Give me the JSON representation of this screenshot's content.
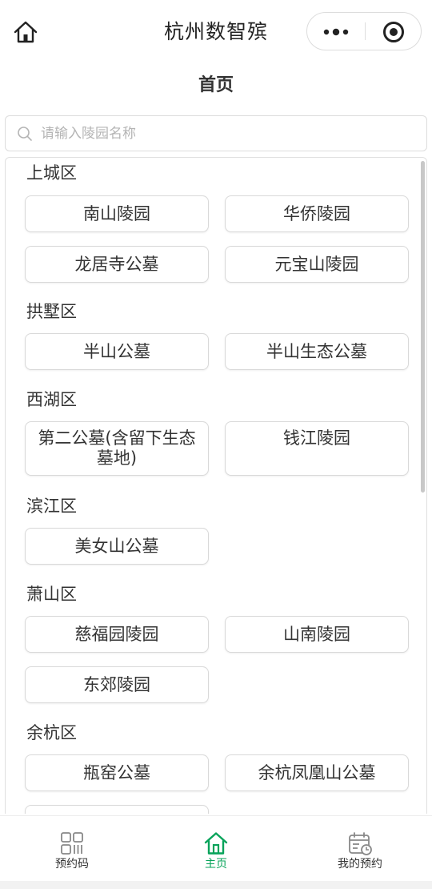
{
  "app": {
    "title": "杭州数智殡"
  },
  "page": {
    "title": "首页"
  },
  "search": {
    "placeholder": "请输入陵园名称",
    "value": ""
  },
  "sections": [
    {
      "name": "上城区",
      "items": [
        "南山陵园",
        "华侨陵园",
        "龙居寺公墓",
        "元宝山陵园"
      ]
    },
    {
      "name": "拱墅区",
      "items": [
        "半山公墓",
        "半山生态公墓"
      ]
    },
    {
      "name": "西湖区",
      "items": [
        "第二公墓(含留下生态墓地)",
        "钱江陵园"
      ]
    },
    {
      "name": "滨江区",
      "items": [
        "美女山公墓"
      ]
    },
    {
      "name": "萧山区",
      "items": [
        "慈福园陵园",
        "山南陵园",
        "东郊陵园"
      ]
    },
    {
      "name": "余杭区",
      "items": [
        "瓶窑公墓",
        "余杭凤凰山公墓",
        ""
      ]
    }
  ],
  "tabbar": {
    "items": [
      {
        "label": "预约码",
        "icon": "qrcode-icon"
      },
      {
        "label": "主页",
        "icon": "home-icon"
      },
      {
        "label": "我的预约",
        "icon": "calendar-clock-icon"
      }
    ],
    "active_index": 1
  },
  "colors": {
    "accent": "#07a35a",
    "text": "#333333",
    "border": "#dcdcdc",
    "placeholder": "#b4b4b4"
  }
}
